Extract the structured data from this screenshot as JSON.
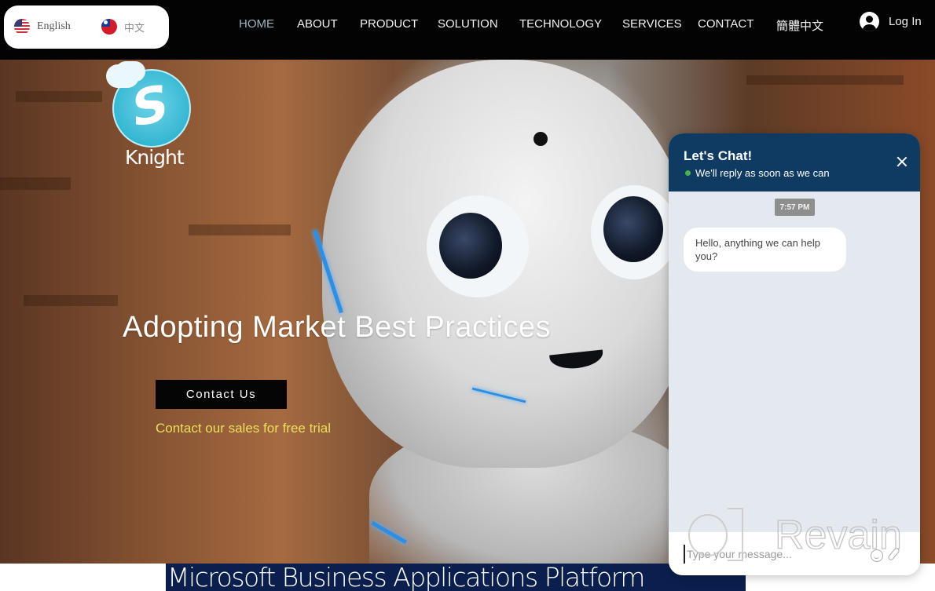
{
  "header": {
    "languages": [
      {
        "label": "English",
        "flag": "us-flag-icon"
      },
      {
        "label": "中文",
        "flag": "taiwan-flag-icon"
      }
    ],
    "nav": [
      {
        "label": "HOME",
        "active": true
      },
      {
        "label": "ABOUT",
        "active": false
      },
      {
        "label": "PRODUCT",
        "active": false
      },
      {
        "label": "SOLUTION",
        "active": false
      },
      {
        "label": "TECHNOLOGY",
        "active": false
      },
      {
        "label": "SERVICES",
        "active": false
      },
      {
        "label": "CONTACT",
        "active": false
      },
      {
        "label": "簡體中文",
        "active": false
      }
    ],
    "login_label": "Log In"
  },
  "hero": {
    "logo_text": "Knight",
    "title": "Adopting Market Best Practices",
    "cta_label": "Contact Us",
    "subtitle": "Contact our sales for free trial"
  },
  "banner": {
    "text": "Microsoft Business Applications Platform"
  },
  "chat": {
    "title": "Let's Chat!",
    "status": "We'll reply as soon as we can",
    "timestamp": "7:57 PM",
    "messages": [
      {
        "from": "agent",
        "text": "Hello, anything we can help you?"
      }
    ],
    "input_placeholder": "Type your message...",
    "colors": {
      "header": "#0f3b63",
      "online": "#4caf50"
    }
  },
  "watermark": {
    "text": "Revain"
  },
  "colors": {
    "nav_active": "#9fb4c4",
    "subtitle": "#ecdf5d",
    "banner_bg": "#0b1f4e"
  }
}
